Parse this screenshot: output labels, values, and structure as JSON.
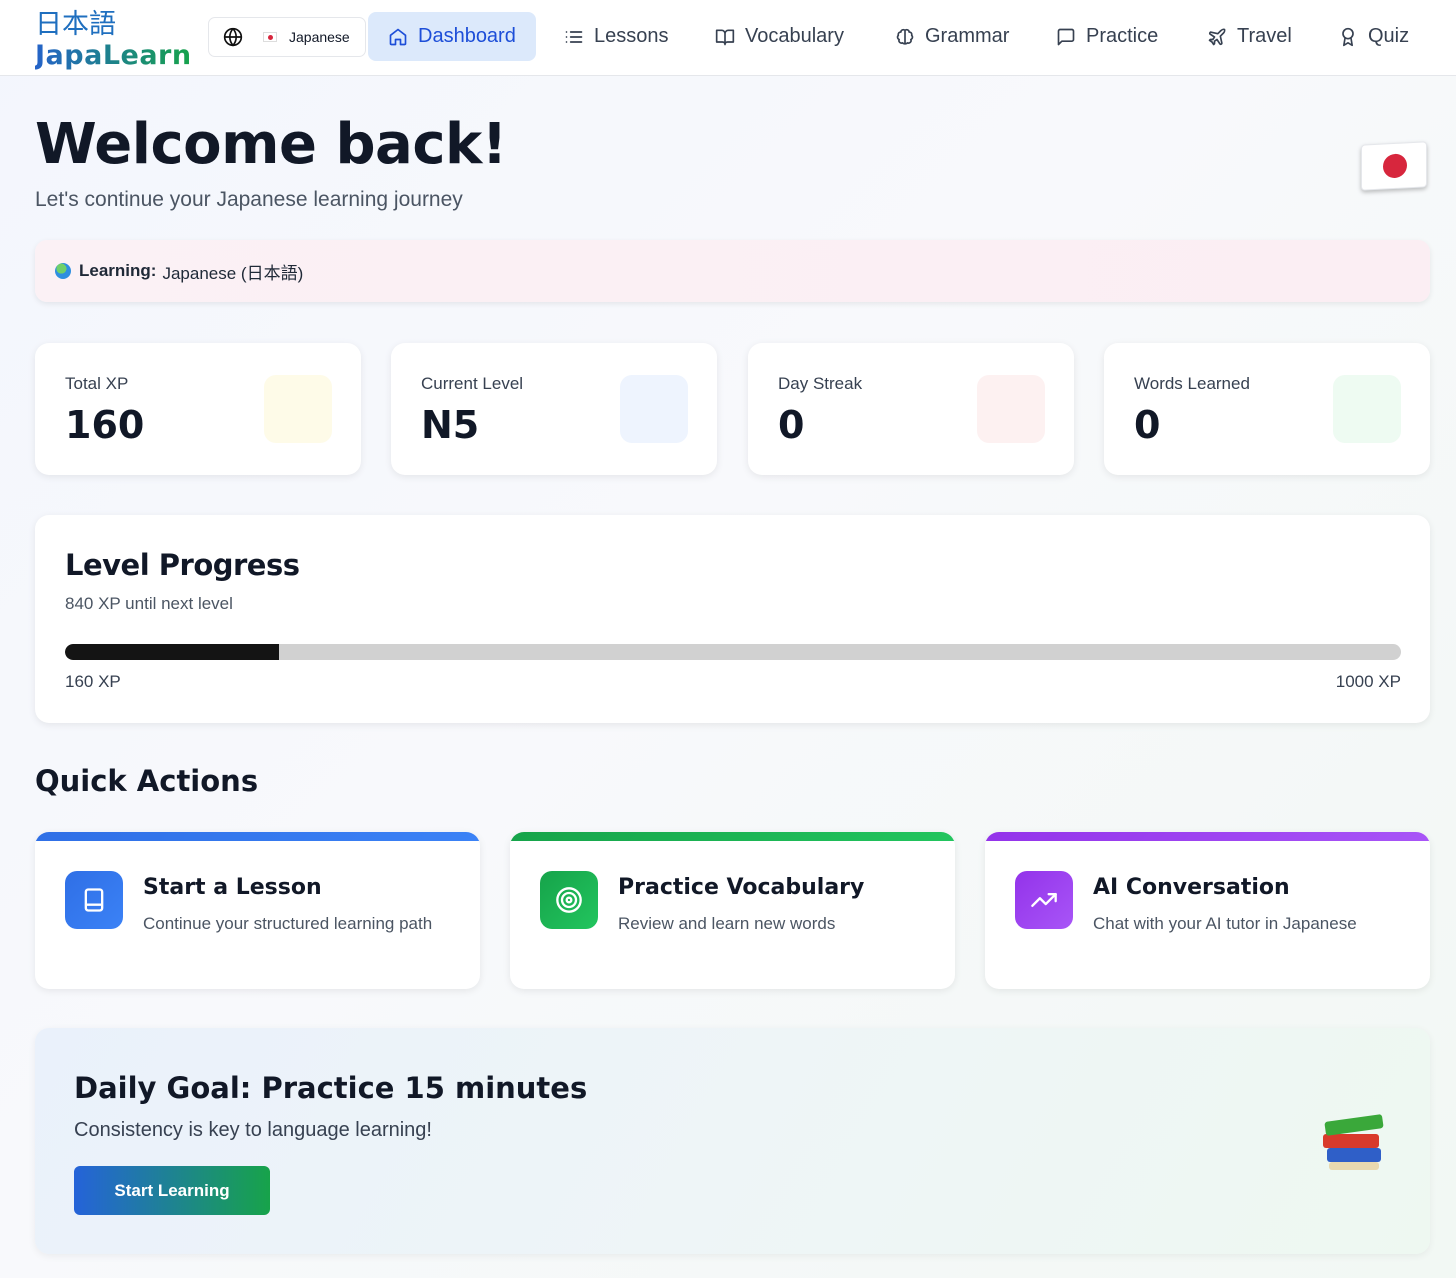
{
  "brand": {
    "japanese": "日本語",
    "name": "JapaLearn"
  },
  "language_selector": {
    "label": "Japanese"
  },
  "nav": {
    "items": [
      {
        "label": "Dashboard",
        "icon": "home-icon",
        "active": true
      },
      {
        "label": "Lessons",
        "icon": "list-icon"
      },
      {
        "label": "Vocabulary",
        "icon": "book-open-icon"
      },
      {
        "label": "Grammar",
        "icon": "brain-icon"
      },
      {
        "label": "Practice",
        "icon": "message-icon"
      },
      {
        "label": "Travel",
        "icon": "plane-icon"
      },
      {
        "label": "Quiz",
        "icon": "award-icon"
      }
    ]
  },
  "hero": {
    "title": "Welcome back!",
    "subtitle": "Let's continue your Japanese learning journey"
  },
  "learning_bar": {
    "label": "Learning:",
    "value": "Japanese (日本語)"
  },
  "stats": [
    {
      "label": "Total XP",
      "value": "160",
      "icon_color": "#fefbe8"
    },
    {
      "label": "Current Level",
      "value": "N5",
      "icon_color": "#eef4fe"
    },
    {
      "label": "Day Streak",
      "value": "0",
      "icon_color": "#fdf1f1"
    },
    {
      "label": "Words Learned",
      "value": "0",
      "icon_color": "#eefbf2"
    }
  ],
  "level_progress": {
    "title": "Level Progress",
    "subtitle": "840 XP until next level",
    "current_label": "160 XP",
    "target_label": "1000 XP",
    "fraction": 0.16
  },
  "quick_actions": {
    "heading": "Quick Actions",
    "items": [
      {
        "title": "Start a Lesson",
        "description": "Continue your structured learning path",
        "icon": "book-icon",
        "color_start": "#2f6fe6",
        "color_end": "#3b82f6"
      },
      {
        "title": "Practice Vocabulary",
        "description": "Review and learn new words",
        "icon": "target-icon",
        "color_start": "#16a34a",
        "color_end": "#22c55e"
      },
      {
        "title": "AI Conversation",
        "description": "Chat with your AI tutor in Japanese",
        "icon": "trending-up-icon",
        "color_start": "#9333ea",
        "color_end": "#a855f7"
      }
    ]
  },
  "daily_goal": {
    "title": "Daily Goal: Practice 15 minutes",
    "subtitle": "Consistency is key to language learning!",
    "button": "Start Learning"
  }
}
